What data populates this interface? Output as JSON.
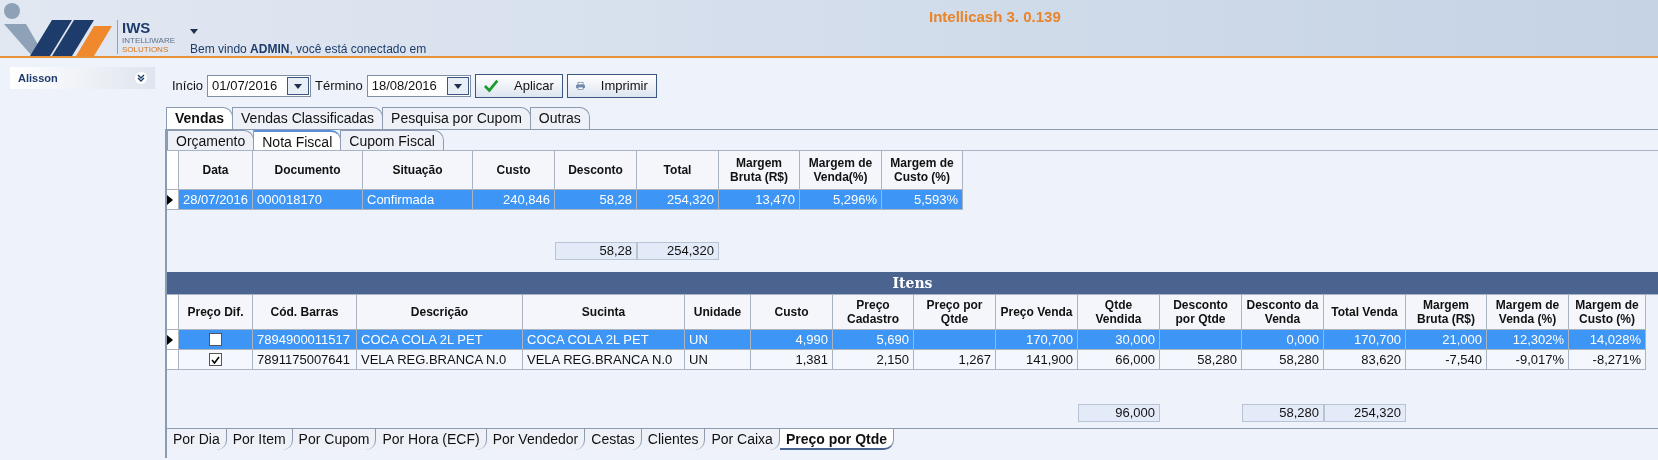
{
  "header": {
    "title": "Intellicash 3. 0.139",
    "logo": {
      "name": "IWS",
      "tagline": [
        "INTELLIWARE",
        "SOLUTIONS"
      ]
    },
    "welcome": "Bem vindo **ADMIN**, você está conectado em"
  },
  "sidebar": {
    "user": "Alisson"
  },
  "filter": {
    "start_label": "Início",
    "start": "01/07/2016",
    "end_label": "Término",
    "end": "18/08/2016",
    "buttons": [
      {
        "kind": "apply",
        "label": "Aplicar"
      },
      {
        "kind": "print",
        "label": "Imprimir"
      }
    ]
  },
  "main_tabs": [
    {
      "label": "Vendas",
      "selected": true
    },
    {
      "label": "Vendas Classificadas",
      "selected": false
    },
    {
      "label": "Pesquisa por Cupom",
      "selected": false
    },
    {
      "label": "Outras",
      "selected": false
    }
  ],
  "sub_tabs": [
    {
      "label": "Orçamento",
      "selected": false
    },
    {
      "label": "Nota Fiscal",
      "selected": true
    },
    {
      "label": "Cupom Fiscal",
      "selected": false
    }
  ],
  "sales_table": {
    "columns": [
      "Data",
      "Documento",
      "Situação",
      "Custo",
      "Desconto",
      "Total",
      "Margem Bruta (R$)",
      "Margem de Venda(%)",
      "Margem de Custo (%)"
    ],
    "rows": [
      {
        "selected": true,
        "cells": [
          "28/07/2016",
          "000018170",
          "Confirmada",
          "240,846",
          "58,28",
          "254,320",
          "13,470",
          "5,296%",
          "5,593%"
        ]
      }
    ],
    "totals": {
      "desconto": "58,28",
      "total": "254,320"
    }
  },
  "items": {
    "title": "Itens",
    "columns": [
      "Preço Dif.",
      "Cód. Barras",
      "Descrição",
      "Sucinta",
      "Unidade",
      "Custo",
      "Preço Cadastro",
      "Preço por Qtde",
      "Preço Venda",
      "Qtde Vendida",
      "Desconto por Qtde",
      "Desconto da Venda",
      "Total Venda",
      "Margem Bruta (R$)",
      "Margem de Venda (%)",
      "Margem de Custo (%)"
    ],
    "rows": [
      {
        "selected": true,
        "cells": [
          {
            "checked": false
          },
          "7894900011517",
          "COCA COLA 2L PET",
          "COCA COLA 2L PET",
          "UN",
          "4,990",
          "5,690",
          null,
          "170,700",
          "30,000",
          null,
          "0,000",
          "170,700",
          "21,000",
          "12,302%",
          "14,028%"
        ]
      },
      {
        "selected": false,
        "cells": [
          {
            "checked": true
          },
          "7891175007641",
          "VELA REG.BRANCA N.0",
          "VELA REG.BRANCA N.0",
          "UN",
          "1,381",
          "2,150",
          "1,267",
          "141,900",
          "66,000",
          "58,280",
          "58,280",
          "83,620",
          "-7,540",
          "-9,017%",
          "-8,271%"
        ]
      }
    ],
    "totals": {
      "qtde_vendida": "96,000",
      "desconto_da_venda": "58,280",
      "total_venda": "254,320"
    }
  },
  "bottom_tabs": [
    {
      "label": "Por Dia",
      "selected": false
    },
    {
      "label": "Por Item",
      "selected": false
    },
    {
      "label": "Por Cupom",
      "selected": false
    },
    {
      "label": "Por Hora (ECF)",
      "selected": false
    },
    {
      "label": "Por Vendedor",
      "selected": false
    },
    {
      "label": "Cestas",
      "selected": false
    },
    {
      "label": "Clientes",
      "selected": false
    },
    {
      "label": "Por Caixa",
      "selected": false
    },
    {
      "label": "Preço por Qtde",
      "selected": true
    }
  ]
}
